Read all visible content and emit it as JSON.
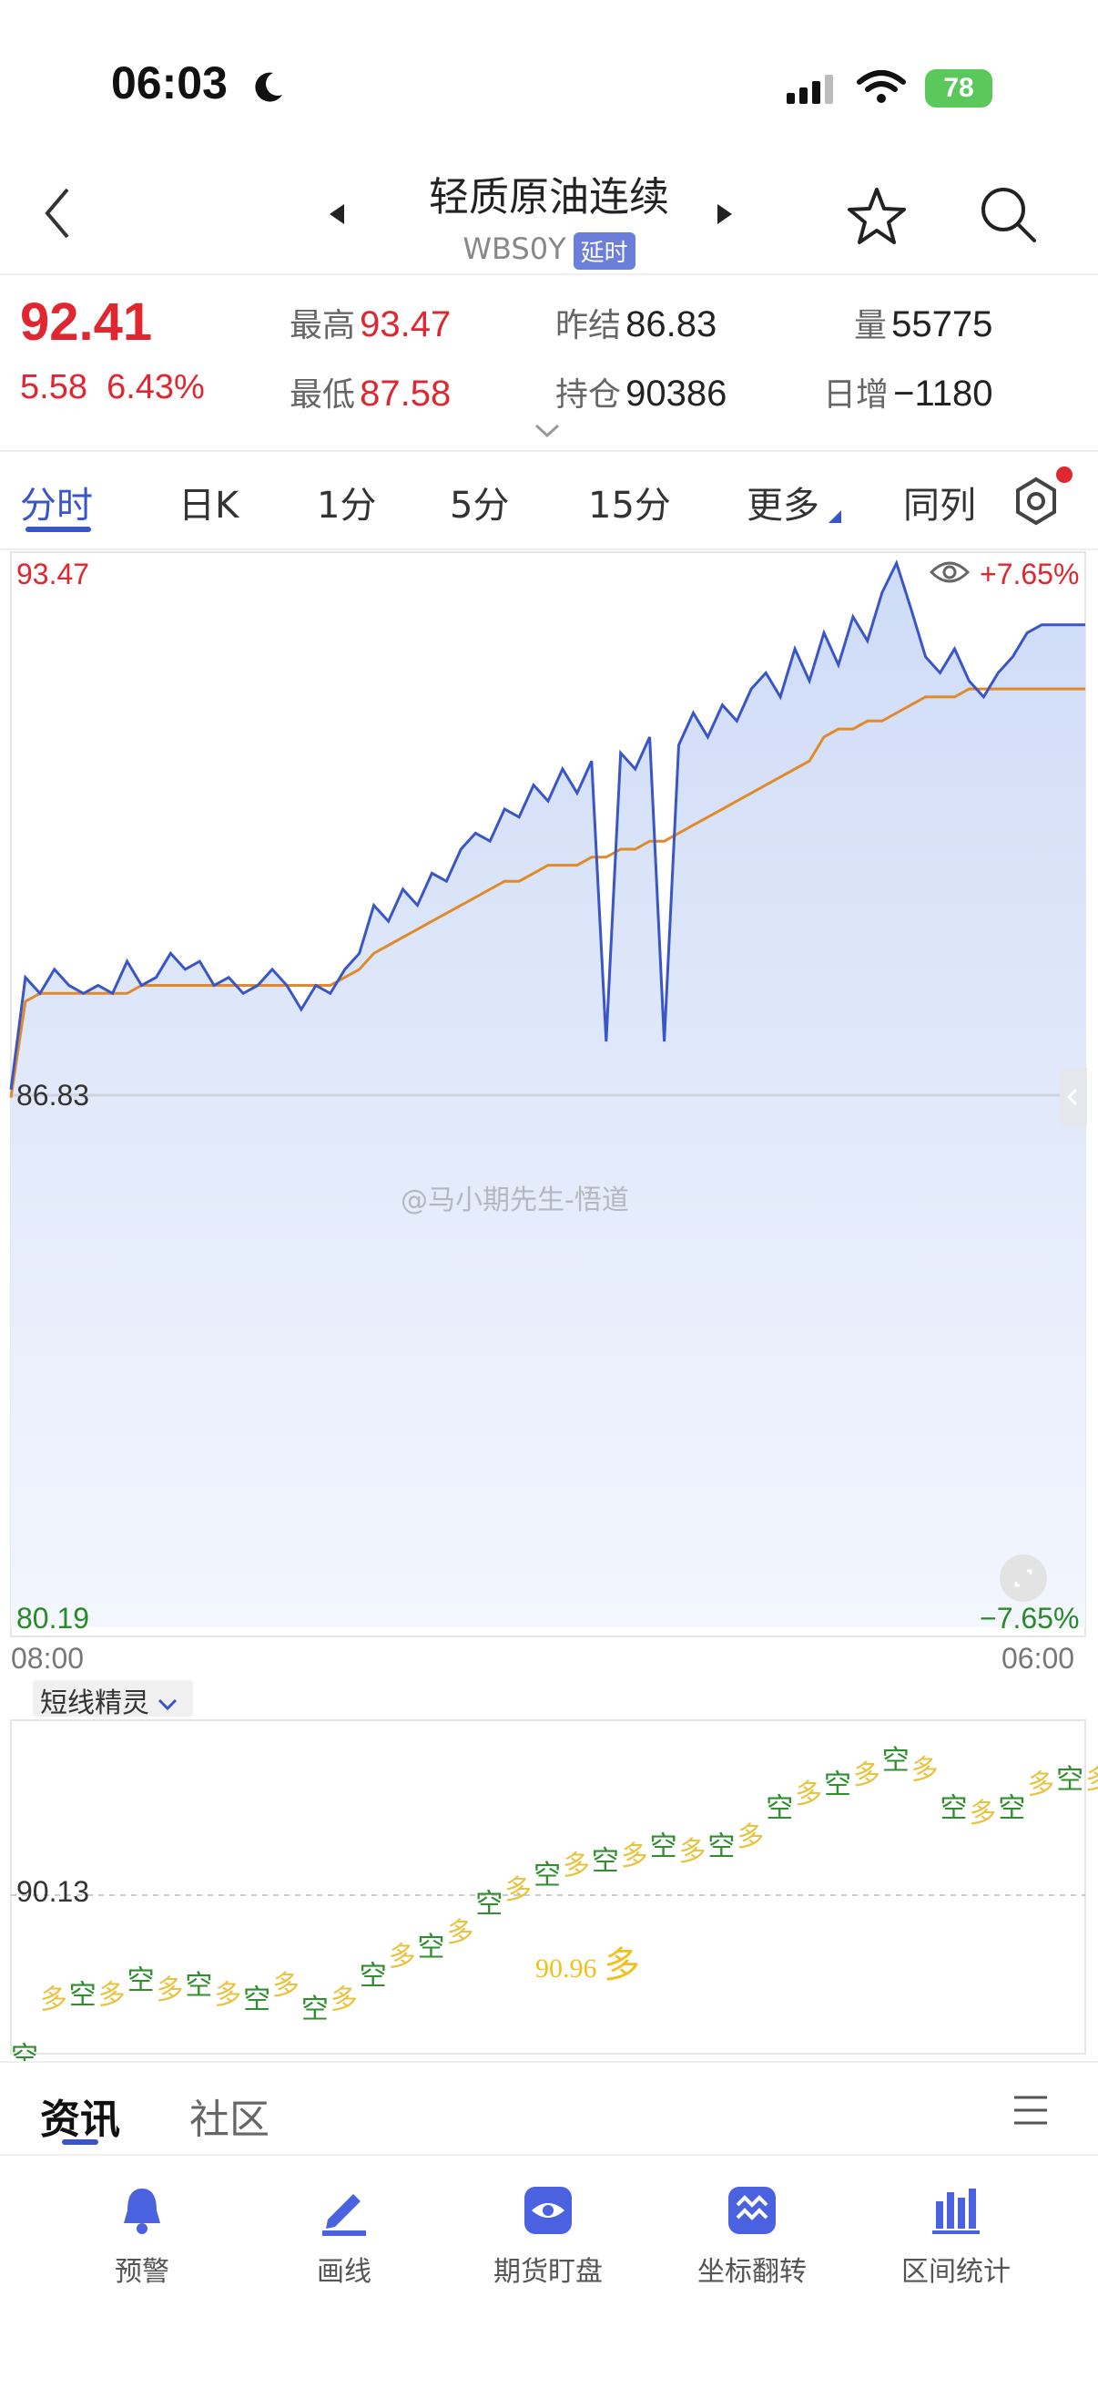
{
  "status": {
    "time": "06:03",
    "battery": "78"
  },
  "header": {
    "title": "轻质原油连续",
    "code": "WBS0Y",
    "tag": "延时"
  },
  "quote": {
    "price": "92.41",
    "change": "5.58",
    "change_pct": "6.43%",
    "high_label": "最高",
    "high": "93.47",
    "low_label": "最低",
    "low": "87.58",
    "prev_label": "昨结",
    "prev": "86.83",
    "oi_label": "持仓",
    "oi": "90386",
    "vol_label": "量",
    "vol": "55775",
    "daily_label": "日增",
    "daily": "−1180"
  },
  "tabs": [
    "分时",
    "日K",
    "1分",
    "5分",
    "15分",
    "更多",
    "同列"
  ],
  "chart": {
    "y_top": "93.47",
    "y_mid": "86.83",
    "y_bottom": "80.19",
    "pct_top": "+7.65%",
    "pct_bottom": "−7.65%",
    "x_start": "08:00",
    "x_end": "06:00",
    "watermark": "@马小期先生-悟道"
  },
  "indicator": {
    "name": "短线精灵",
    "level": "90.13",
    "sample_price": "90.96",
    "sample_signal": "多"
  },
  "bottom_tabs": [
    "资讯",
    "社区"
  ],
  "nav": [
    {
      "label": "预警",
      "icon": "bell-icon"
    },
    {
      "label": "画线",
      "icon": "pen-icon"
    },
    {
      "label": "期货盯盘",
      "icon": "eye-icon"
    },
    {
      "label": "坐标翻转",
      "icon": "flip-icon"
    },
    {
      "label": "区间统计",
      "icon": "stats-icon"
    }
  ],
  "colors": {
    "up": "#e0262f",
    "down": "#2a8a2a",
    "accent": "#3a55c8",
    "avg_line": "#e08a2a"
  },
  "chart_data": {
    "type": "line",
    "ylim": [
      80.19,
      93.47
    ],
    "x": [
      "08:00",
      "06:00"
    ],
    "series": [
      {
        "values": [
          86.9,
          88.3,
          88.1,
          88.4,
          88.2,
          88.1,
          88.2,
          88.1,
          88.5,
          88.2,
          88.3,
          88.6,
          88.4,
          88.5,
          88.2,
          88.3,
          88.1,
          88.2,
          88.4,
          88.2,
          87.9,
          88.2,
          88.1,
          88.4,
          88.6,
          89.2,
          89.0,
          89.4,
          89.2,
          89.6,
          89.5,
          89.9,
          90.1,
          90.0,
          90.4,
          90.3,
          90.7,
          90.5,
          90.9,
          90.6,
          91.0,
          87.5,
          91.1,
          90.9,
          91.3,
          87.5,
          91.2,
          91.6,
          91.3,
          91.7,
          91.5,
          91.9,
          92.1,
          91.8,
          92.4,
          92.0,
          92.6,
          92.2,
          92.8,
          92.5,
          93.1,
          93.47,
          92.9,
          92.3,
          92.1,
          92.4,
          92.0,
          91.8,
          92.1,
          92.3,
          92.6,
          92.7,
          92.7,
          92.7,
          92.7
        ]
      },
      {
        "values": [
          86.8,
          88.0,
          88.1,
          88.1,
          88.1,
          88.1,
          88.1,
          88.1,
          88.1,
          88.2,
          88.2,
          88.2,
          88.2,
          88.2,
          88.2,
          88.2,
          88.2,
          88.2,
          88.2,
          88.2,
          88.2,
          88.2,
          88.2,
          88.3,
          88.4,
          88.6,
          88.7,
          88.8,
          88.9,
          89.0,
          89.1,
          89.2,
          89.3,
          89.4,
          89.5,
          89.5,
          89.6,
          89.7,
          89.7,
          89.7,
          89.8,
          89.8,
          89.9,
          89.9,
          90.0,
          90.0,
          90.1,
          90.2,
          90.3,
          90.4,
          90.5,
          90.6,
          90.7,
          90.8,
          90.9,
          91.0,
          91.3,
          91.4,
          91.4,
          91.5,
          91.5,
          91.6,
          91.7,
          91.8,
          91.8,
          91.8,
          91.9,
          91.9,
          91.9,
          91.9,
          91.9,
          91.9,
          91.9,
          91.9,
          91.9
        ]
      }
    ]
  }
}
